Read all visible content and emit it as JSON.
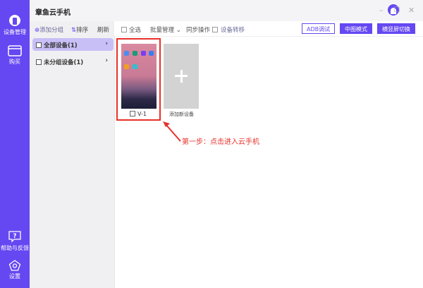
{
  "app": {
    "title": "章鱼云手机"
  },
  "rail": {
    "items": [
      {
        "label": "设备管理"
      },
      {
        "label": "购买"
      },
      {
        "label": "帮助与反馈"
      },
      {
        "label": "设置"
      }
    ]
  },
  "left_panel": {
    "add_group": "添加分组",
    "sort": "排序",
    "refresh": "刷新",
    "groups": [
      {
        "label": "全部设备(1)"
      },
      {
        "label": "未分组设备(1)"
      }
    ]
  },
  "toolbar": {
    "select_all": "全选",
    "batch": "批量管理",
    "sync": "同步操作",
    "transfer": "设备转移",
    "adb": "ADB调试",
    "mode": "中图模式",
    "orientation": "横竖屏切换"
  },
  "devices": [
    {
      "name": "V-1"
    }
  ],
  "add_device": "添加新设备",
  "annotation": "第一步：点击进入云手机",
  "colors": {
    "accent": "#6548f2",
    "annotation": "#e8302a"
  }
}
